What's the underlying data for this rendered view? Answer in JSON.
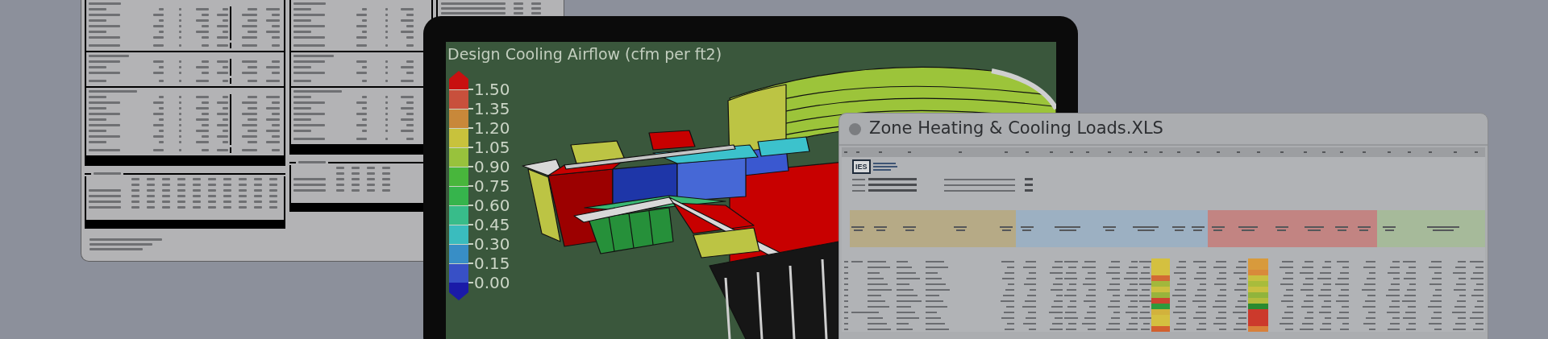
{
  "viewer": {
    "title": "Design Cooling Airflow (cfm per ft2)",
    "legend": {
      "ticks": [
        "1.50",
        "1.35",
        "1.20",
        "1.05",
        "0.90",
        "0.75",
        "0.60",
        "0.45",
        "0.30",
        "0.15",
        "0.00"
      ],
      "bands": [
        {
          "color": "#c8503c"
        },
        {
          "color": "#c8883a"
        },
        {
          "color": "#c8c23c"
        },
        {
          "color": "#98c23c"
        },
        {
          "color": "#48b63c"
        },
        {
          "color": "#36b44c"
        },
        {
          "color": "#38bc8a"
        },
        {
          "color": "#3abcbe"
        },
        {
          "color": "#388ec6"
        },
        {
          "color": "#3850c6"
        }
      ]
    }
  },
  "sheet": {
    "title": "Zone Heating & Cooling Loads.XLS",
    "logo": {
      "mark": "IES"
    }
  }
}
